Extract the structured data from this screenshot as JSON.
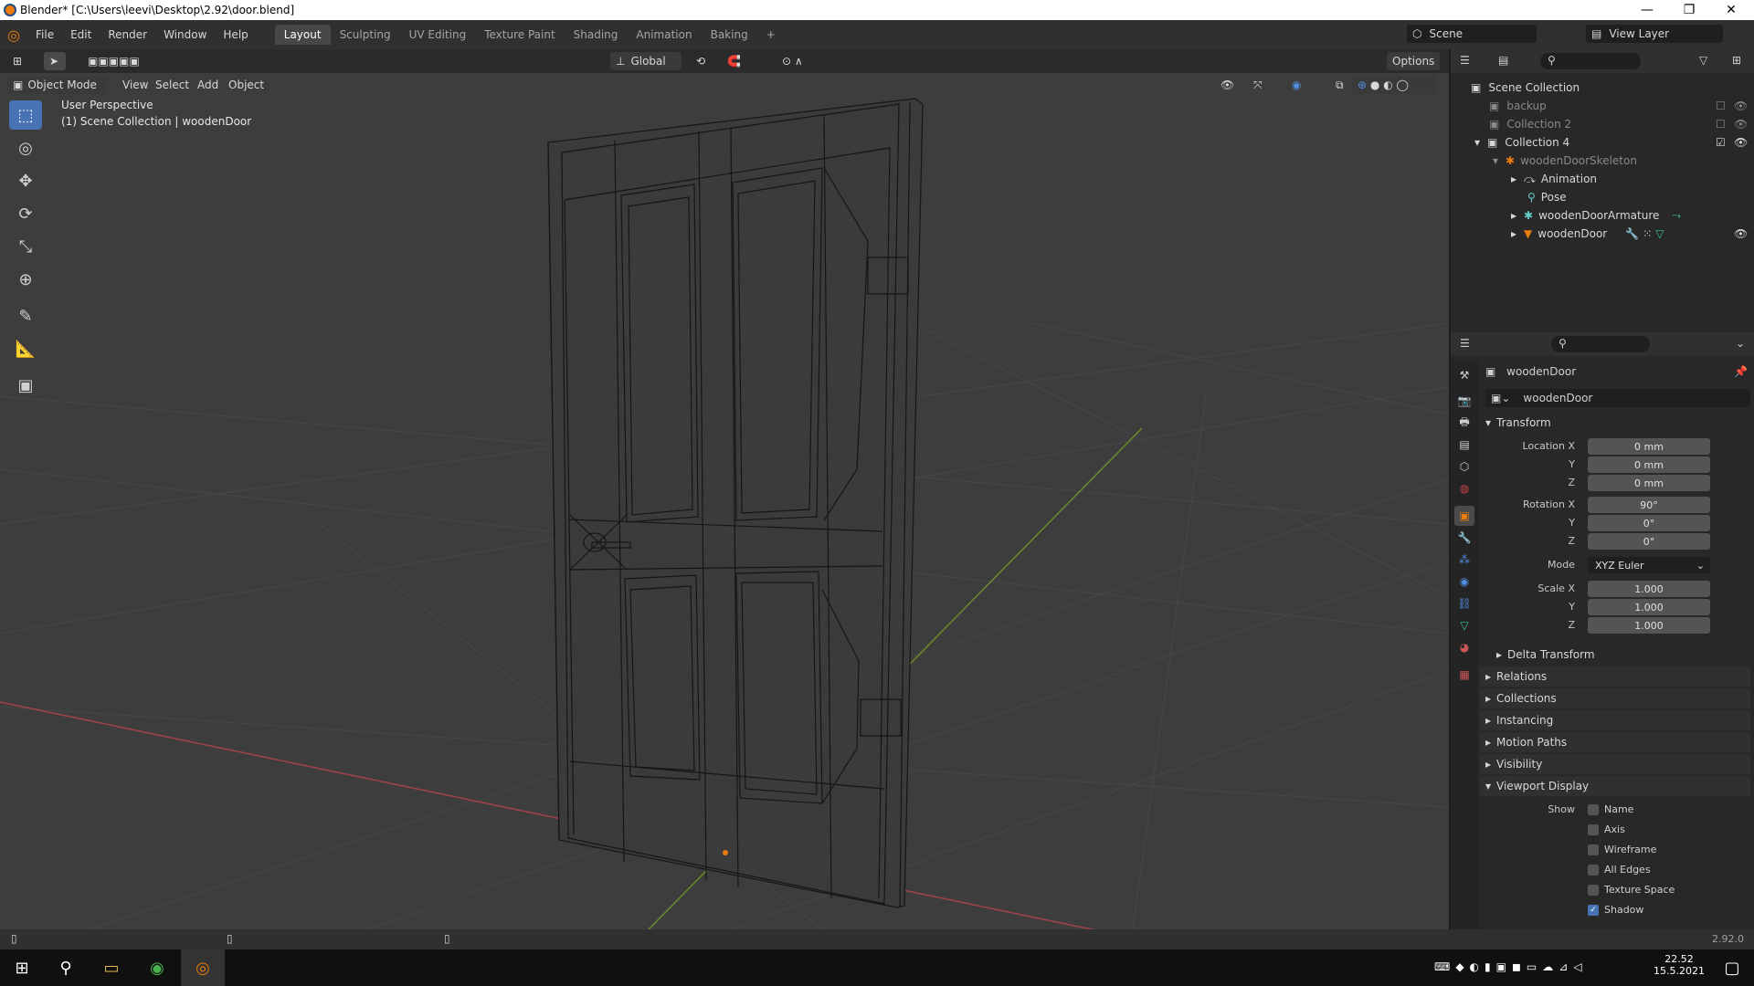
{
  "window": {
    "title": "Blender* [C:\\Users\\leevi\\Desktop\\2.92\\door.blend]",
    "controls": [
      "—",
      "❐",
      "✕"
    ]
  },
  "menubar": {
    "menus": [
      "File",
      "Edit",
      "Render",
      "Window",
      "Help"
    ],
    "workspaces": [
      "Layout",
      "Sculpting",
      "UV Editing",
      "Texture Paint",
      "Shading",
      "Animation",
      "Baking"
    ],
    "active_workspace": "Layout",
    "add_tab": "+",
    "scene": "Scene",
    "view_layer": "View Layer"
  },
  "viewport": {
    "mode": "Object Mode",
    "menus": [
      "View",
      "Select",
      "Add",
      "Object"
    ],
    "orientation": "Global",
    "options": "Options",
    "perspective": "User Perspective",
    "collection_info": "(1) Scene Collection | woodenDoor"
  },
  "toolbar": {
    "tools": [
      "select-box-icon",
      "cursor-icon",
      "move-icon",
      "rotate-icon",
      "scale-icon",
      "transform-icon",
      "annotate-icon",
      "measure-icon",
      "add-cube-icon"
    ]
  },
  "outliner": {
    "root": "Scene Collection",
    "items": [
      {
        "label": "backup",
        "dim": true
      },
      {
        "label": "Collection 2",
        "dim": true
      },
      {
        "label": "Collection 4",
        "dim": false
      },
      {
        "label": "woodenDoorSkeleton",
        "dim": true
      },
      {
        "label": "Animation",
        "dim": false
      },
      {
        "label": "Pose",
        "dim": false
      },
      {
        "label": "woodenDoorArmature",
        "dim": false
      },
      {
        "label": "woodenDoor",
        "dim": false
      }
    ]
  },
  "properties": {
    "object_name": "woodenDoor",
    "data_name": "woodenDoor",
    "transform_title": "Transform",
    "location_label": "Location X",
    "rotation_label": "Rotation X",
    "scale_label": "Scale X",
    "y_label": "Y",
    "z_label": "Z",
    "location": [
      "0 mm",
      "0 mm",
      "0 mm"
    ],
    "rotation": [
      "90°",
      "0°",
      "0°"
    ],
    "mode_label": "Mode",
    "mode_value": "XYZ Euler",
    "scale": [
      "1.000",
      "1.000",
      "1.000"
    ],
    "delta_transform": "Delta Transform",
    "sections": [
      "Relations",
      "Collections",
      "Instancing",
      "Motion Paths",
      "Visibility"
    ],
    "viewport_display": "Viewport Display",
    "show_label": "Show",
    "show_options": [
      {
        "label": "Name",
        "checked": false
      },
      {
        "label": "Axis",
        "checked": false
      },
      {
        "label": "Wireframe",
        "checked": false
      },
      {
        "label": "All Edges",
        "checked": false
      },
      {
        "label": "Texture Space",
        "checked": false
      },
      {
        "label": "Shadow",
        "checked": true
      }
    ]
  },
  "statusbar": {
    "version": "2.92.0"
  },
  "taskbar": {
    "time": "22.52",
    "date": "15.5.2021"
  }
}
